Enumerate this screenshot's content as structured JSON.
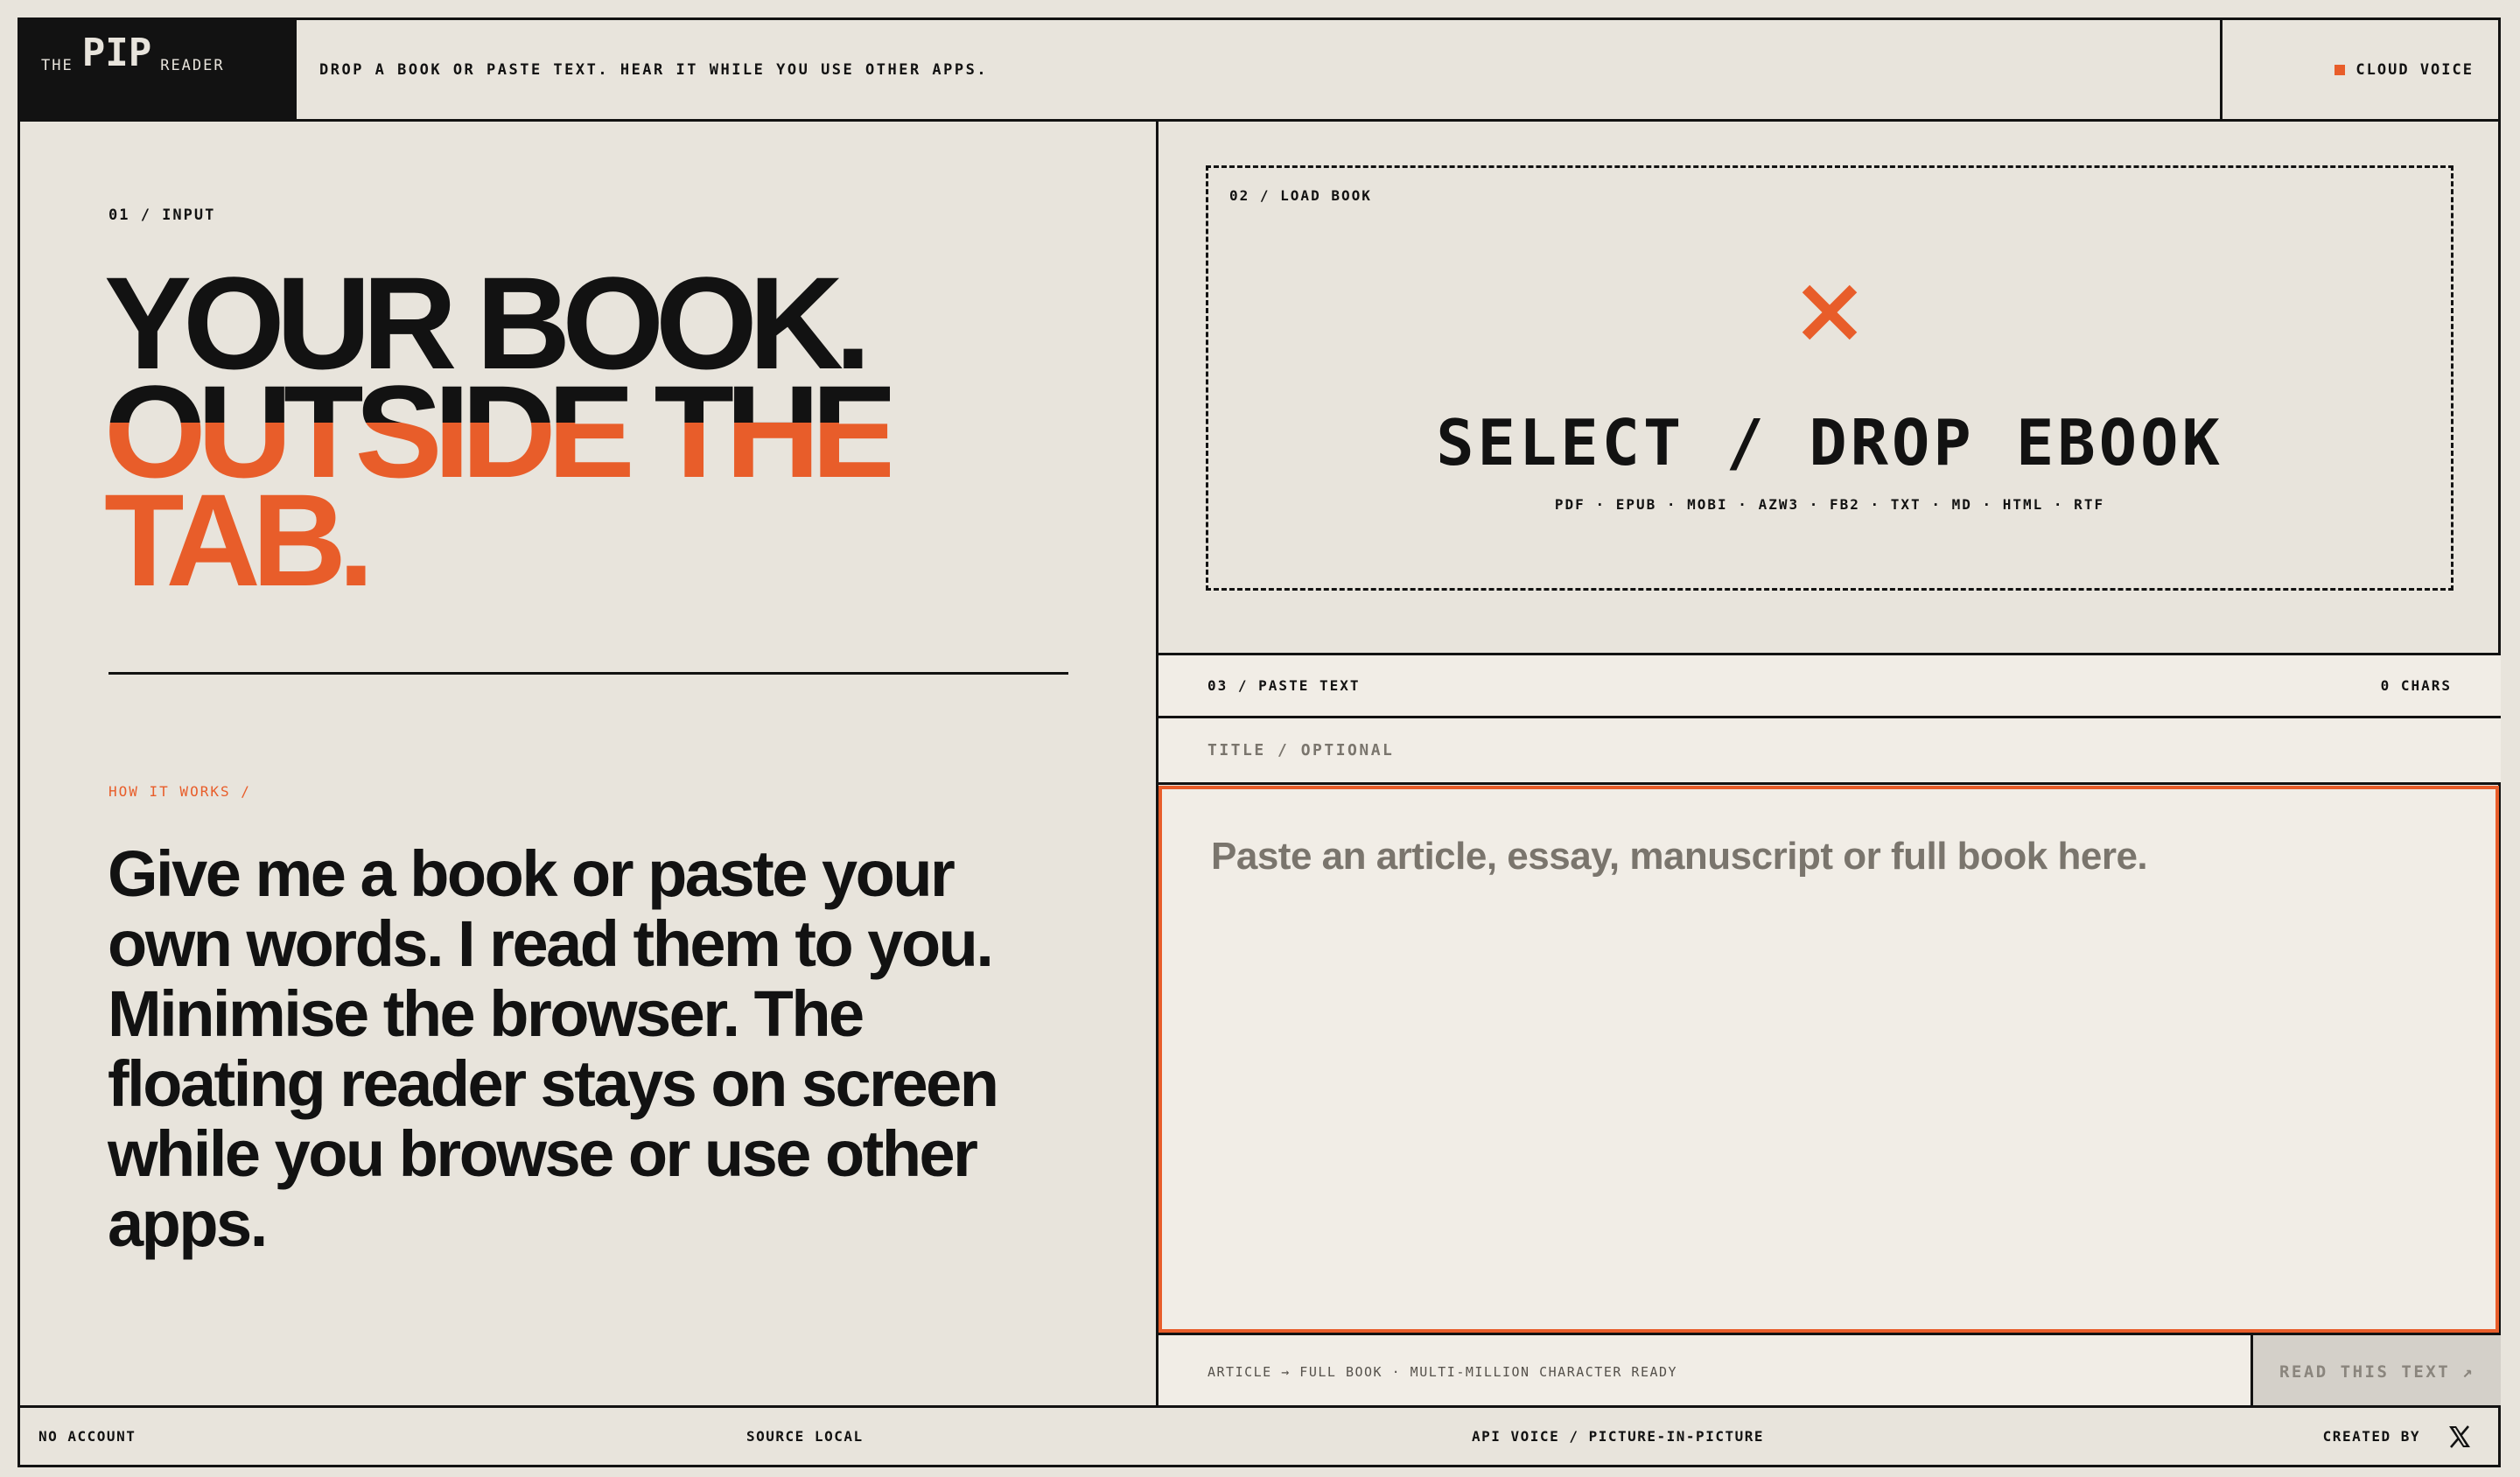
{
  "header": {
    "logo_the": "THE",
    "logo_pip": "PIP",
    "logo_reader": "READER",
    "tagline": "DROP A BOOK OR PASTE TEXT. HEAR IT WHILE YOU USE OTHER APPS.",
    "voice_label": "CLOUD VOICE"
  },
  "left": {
    "section_label": "01 / INPUT",
    "headline": [
      "YOUR BOOK.",
      "OUTSIDE THE",
      "TAB."
    ],
    "how_label": "HOW IT WORKS /",
    "body": "Give me a book or paste your own words. I read them to you. Minimise the browser. The floating reader stays on screen while you browse or use other apps."
  },
  "load": {
    "section_label": "02 / LOAD BOOK",
    "title": "SELECT / DROP EBOOK",
    "formats": "PDF · EPUB · MOBI · AZW3 · FB2 · TXT · MD · HTML · RTF"
  },
  "paste": {
    "section_label": "03 / PASTE TEXT",
    "char_count": "0 CHARS",
    "title_placeholder": "TITLE / OPTIONAL",
    "text_placeholder": "Paste an article, essay, manuscript or full book here.",
    "capacity_note": "ARTICLE → FULL BOOK · MULTI-MILLION CHARACTER READY",
    "read_button": "READ THIS TEXT ↗"
  },
  "footer": {
    "account": "NO ACCOUNT",
    "source": "SOURCE LOCAL",
    "features": "API VOICE / PICTURE-IN-PICTURE",
    "created_by": "CREATED BY"
  },
  "colors": {
    "background": "#e8e4dc",
    "ink": "#121212",
    "accent": "#e85d2a",
    "panel": "#f1ede6"
  }
}
